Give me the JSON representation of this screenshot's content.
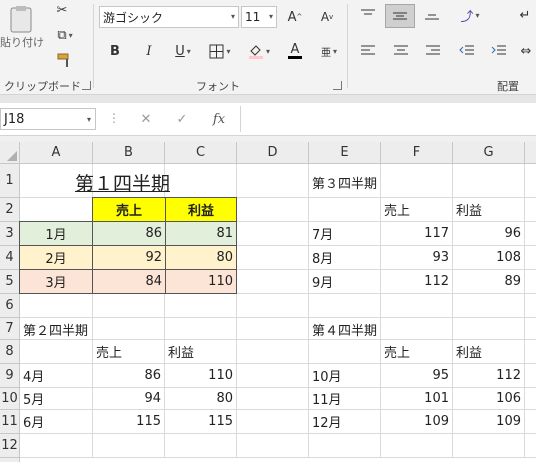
{
  "ribbon": {
    "clipboard": {
      "paste_label": "貼り付け",
      "group_label": "クリップボード"
    },
    "font": {
      "font_name": "游ゴシック",
      "font_size": "11",
      "grow_label": "A",
      "shrink_label": "A",
      "bold_label": "B",
      "italic_label": "I",
      "underline_label": "U",
      "font_color_label": "A",
      "phonetic_label": "亜",
      "group_label": "フォント"
    },
    "alignment": {
      "group_label": "配置"
    }
  },
  "formula_bar": {
    "name_box": "J18",
    "fx_label": "fx",
    "formula": ""
  },
  "columns": [
    "A",
    "B",
    "C",
    "D",
    "E",
    "F",
    "G"
  ],
  "rows": [
    "1",
    "2",
    "3",
    "4",
    "5",
    "6",
    "7",
    "8",
    "9",
    "10",
    "11",
    "12"
  ],
  "q1": {
    "title": "第１四半期",
    "headers": [
      "売上",
      "利益"
    ],
    "rows": [
      {
        "month": "1月",
        "sales": "86",
        "profit": "81",
        "color": "#e2efda"
      },
      {
        "month": "2月",
        "sales": "92",
        "profit": "80",
        "color": "#fff2cc"
      },
      {
        "month": "3月",
        "sales": "84",
        "profit": "110",
        "color": "#fce4d6"
      }
    ],
    "header_color": "#ffff00"
  },
  "q2": {
    "title": "第２四半期",
    "headers": [
      "売上",
      "利益"
    ],
    "rows": [
      {
        "month": "4月",
        "sales": "86",
        "profit": "110"
      },
      {
        "month": "5月",
        "sales": "94",
        "profit": "80"
      },
      {
        "month": "6月",
        "sales": "115",
        "profit": "115"
      }
    ]
  },
  "q3": {
    "title": "第３四半期",
    "headers": [
      "売上",
      "利益"
    ],
    "rows": [
      {
        "month": "7月",
        "sales": "117",
        "profit": "96"
      },
      {
        "month": "8月",
        "sales": "93",
        "profit": "108"
      },
      {
        "month": "9月",
        "sales": "112",
        "profit": "89"
      }
    ]
  },
  "q4": {
    "title": "第４四半期",
    "headers": [
      "売上",
      "利益"
    ],
    "rows": [
      {
        "month": "10月",
        "sales": "95",
        "profit": "112"
      },
      {
        "month": "11月",
        "sales": "101",
        "profit": "106"
      },
      {
        "month": "12月",
        "sales": "109",
        "profit": "109"
      }
    ]
  }
}
